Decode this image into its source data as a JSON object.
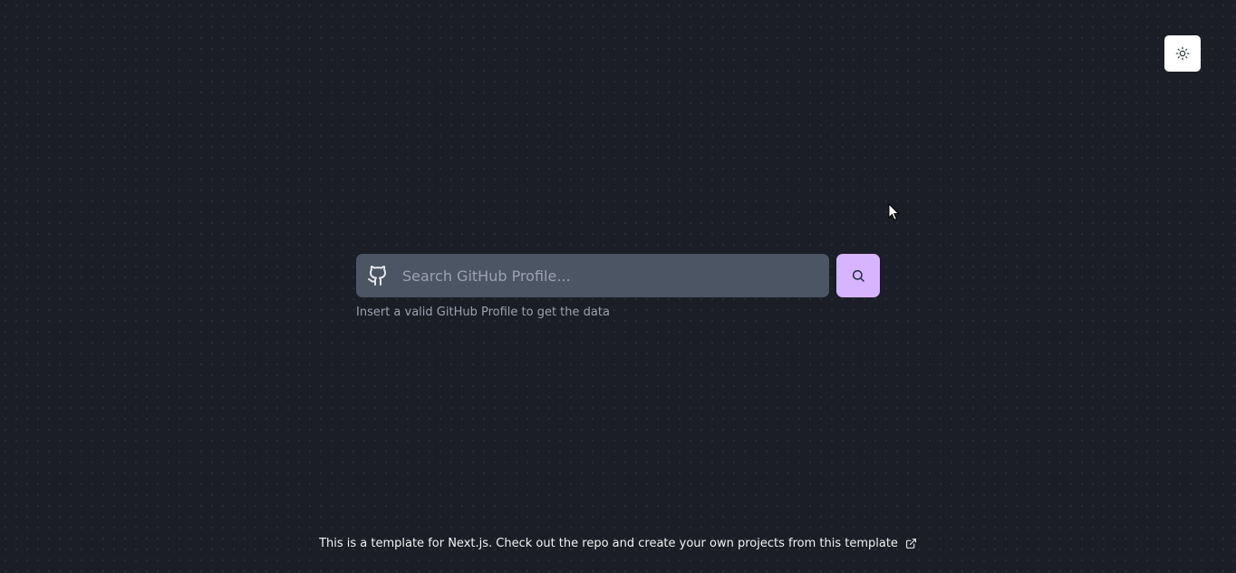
{
  "header": {
    "theme_toggle_icon": "sun-icon"
  },
  "search": {
    "leading_icon": "github-icon",
    "placeholder": "Search GitHub Profile...",
    "value": "",
    "button_icon": "search-icon",
    "hint": "Insert a valid GitHub Profile to get the data"
  },
  "footer": {
    "text": "This is a template for Next.js. Check out the repo and create your own projects from this template",
    "link_icon": "external-link-icon"
  },
  "colors": {
    "background": "#1b1d27",
    "search_box": "#4b5563",
    "search_button": "#d8b4fe",
    "toggle_background": "#ffffff"
  }
}
